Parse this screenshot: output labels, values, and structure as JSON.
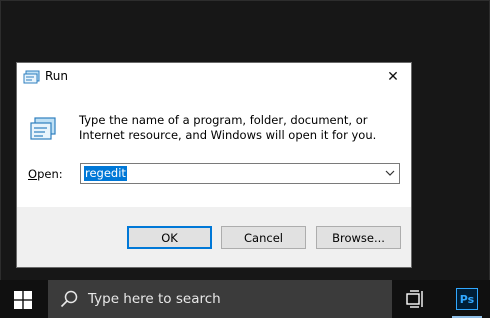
{
  "dialog": {
    "title": "Run",
    "description": "Type the name of a program, folder, document, or Internet resource, and Windows will open it for you.",
    "open_label_prefix": "",
    "open_label_underlined": "O",
    "open_label_rest": "pen:",
    "input_value": "regedit",
    "ok_label": "OK",
    "cancel_label": "Cancel",
    "browse_label": "Browse...",
    "close_glyph": "✕"
  },
  "taskbar": {
    "search_placeholder": "Type here to search",
    "pinned_app_label": "Ps"
  },
  "colors": {
    "accent": "#0078d7",
    "taskbar_bg": "#101010",
    "search_bg": "#3b3b3b",
    "photoshop_blue": "#31a8ff"
  },
  "icons": [
    "run-app-icon",
    "close-icon",
    "dropdown-arrow-icon",
    "windows-start-icon",
    "search-icon",
    "task-view-icon",
    "photoshop-icon"
  ]
}
